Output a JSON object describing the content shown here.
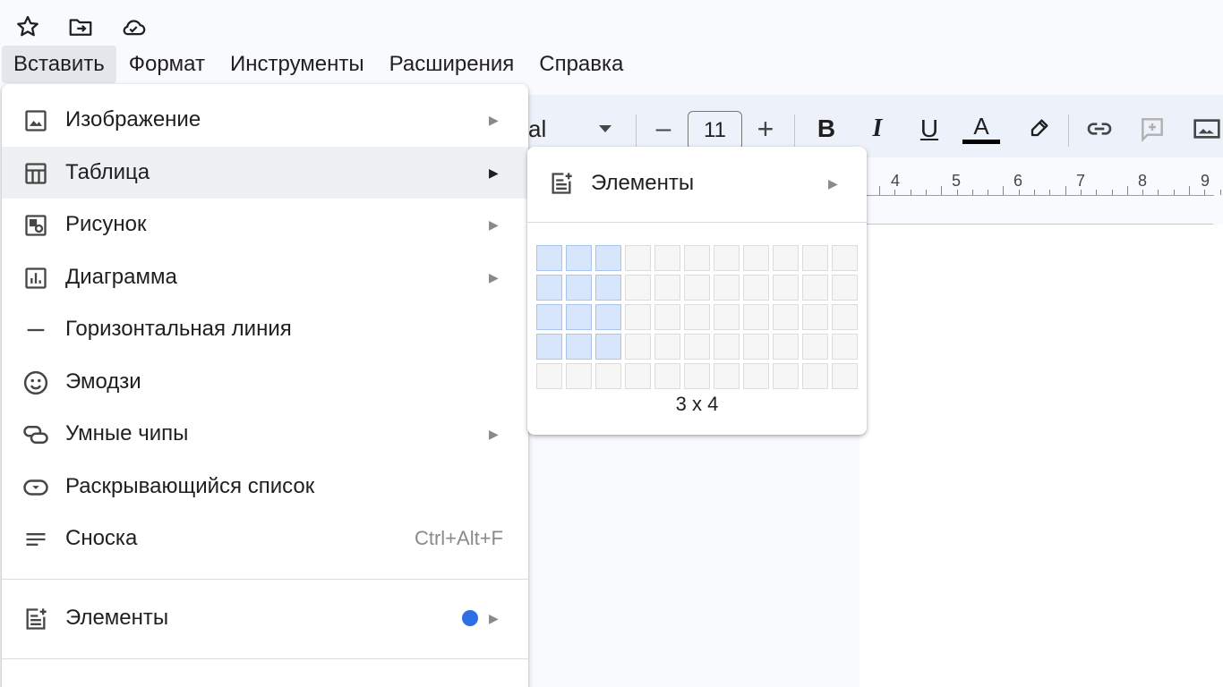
{
  "menubar": {
    "items": [
      "Вставить",
      "Формат",
      "Инструменты",
      "Расширения",
      "Справка"
    ]
  },
  "toolbar": {
    "font_fragment": "al",
    "font_size": "11",
    "bold": "B",
    "italic": "I",
    "underline": "U",
    "text_color": "A",
    "minus": "–",
    "plus": "+"
  },
  "ruler": {
    "numbers": [
      "4",
      "5",
      "6",
      "7",
      "8",
      "9"
    ]
  },
  "insert_menu": {
    "items": [
      {
        "label": "Изображение",
        "icon": "image-icon",
        "has_submenu": true
      },
      {
        "label": "Таблица",
        "icon": "table-icon",
        "has_submenu": true,
        "highlighted": true
      },
      {
        "label": "Рисунок",
        "icon": "drawing-icon",
        "has_submenu": true
      },
      {
        "label": "Диаграмма",
        "icon": "chart-icon",
        "has_submenu": true
      },
      {
        "label": "Горизонтальная линия",
        "icon": "horizontal-line-icon",
        "has_submenu": false
      },
      {
        "label": "Эмодзи",
        "icon": "emoji-icon",
        "has_submenu": false
      },
      {
        "label": "Умные чипы",
        "icon": "smart-chips-icon",
        "has_submenu": true
      },
      {
        "label": "Раскрывающийся список",
        "icon": "dropdown-icon",
        "has_submenu": false
      },
      {
        "label": "Сноска",
        "icon": "footnote-icon",
        "has_submenu": false,
        "shortcut": "Ctrl+Alt+F"
      },
      {
        "label": "Элементы",
        "icon": "building-blocks-icon",
        "has_submenu": true,
        "new_dot": true
      }
    ]
  },
  "table_submenu": {
    "item_label": "Элементы",
    "grid_columns": 11,
    "grid_rows": 5,
    "selected_columns": 3,
    "selected_rows": 4,
    "dimension_label": "3 x 4"
  },
  "colors": {
    "accent_dot": "#2f6fe4",
    "grid_selected": "#d8e6fb",
    "text_color_bar": "#000000"
  }
}
